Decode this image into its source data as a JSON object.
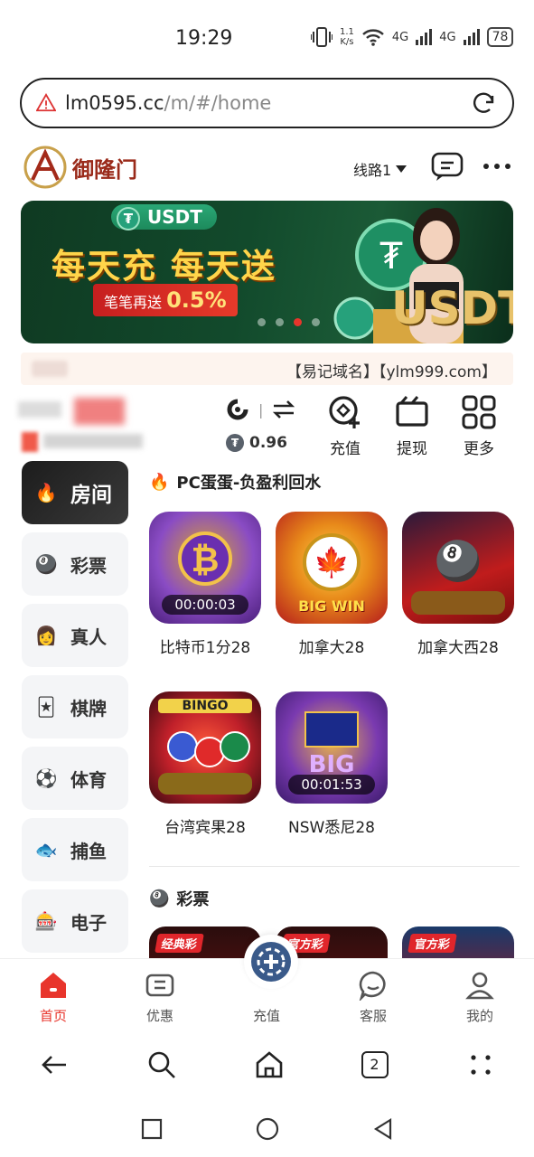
{
  "status": {
    "time": "19:29",
    "speed_top": "1.1",
    "speed_bottom": "K/s",
    "net1": "4G",
    "net2": "4G",
    "battery": "78"
  },
  "browser": {
    "url_host": "lm0595.cc",
    "url_path": "/m/#/home",
    "tab_count": "2"
  },
  "header": {
    "route_label": "线路1",
    "logo_text": "御隆门"
  },
  "banner": {
    "pill": "USDT",
    "headline": "每天充 每天送",
    "sub_prefix": "笔笔再送",
    "sub_value": "0.5%",
    "big_text": "USDT"
  },
  "notice": {
    "text": "【易记域名】【ylm999.com】"
  },
  "wallet": {
    "balance": "0.96",
    "coin_symbol": "₮"
  },
  "actions": [
    {
      "label": "充值"
    },
    {
      "label": "提现"
    },
    {
      "label": "更多"
    }
  ],
  "sidebar": {
    "items": [
      {
        "label": "房间",
        "icon": "🔥"
      },
      {
        "label": "彩票",
        "icon": "🎱"
      },
      {
        "label": "真人",
        "icon": "👩"
      },
      {
        "label": "棋牌",
        "icon": "🃏"
      },
      {
        "label": "体育",
        "icon": "⚽"
      },
      {
        "label": "捕鱼",
        "icon": "🐟"
      },
      {
        "label": "电子",
        "icon": "🎰"
      }
    ]
  },
  "section1": {
    "title": "PC蛋蛋-负盈利回水",
    "games": [
      {
        "name": "比特币1分28",
        "timer": "00:00:03",
        "badge": "₿"
      },
      {
        "name": "加拿大28",
        "timer": "BIG WIN",
        "badge": "🍁"
      },
      {
        "name": "加拿大西28",
        "timer": "",
        "badge": "🎱"
      },
      {
        "name": "台湾宾果28",
        "timer": "",
        "badge": "BINGO"
      },
      {
        "name": "NSW悉尼28",
        "timer": "00:01:53",
        "badge": "BIG"
      }
    ]
  },
  "section2": {
    "title": "彩票",
    "tags": [
      "经典彩",
      "官方彩",
      "官方彩"
    ]
  },
  "bottomnav": [
    {
      "label": "首页"
    },
    {
      "label": "优惠"
    },
    {
      "label": "充值"
    },
    {
      "label": "客服"
    },
    {
      "label": "我的"
    }
  ],
  "colors": {
    "accent": "#e8352c",
    "dark": "#222222"
  }
}
